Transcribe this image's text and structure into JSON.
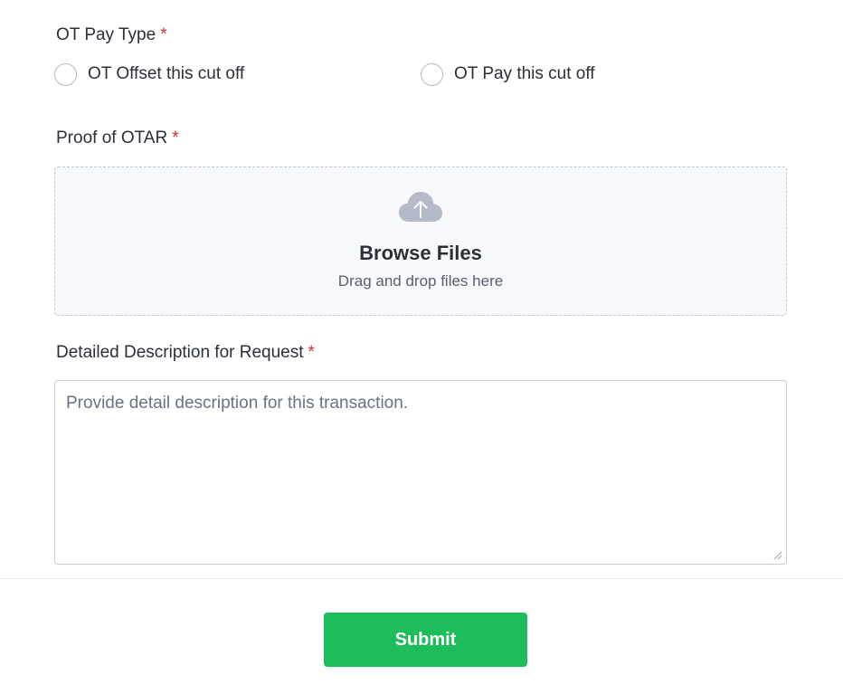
{
  "ot_pay_type": {
    "label": "OT Pay Type",
    "required_mark": "*",
    "options": [
      {
        "label": "OT Offset this cut off",
        "selected": false
      },
      {
        "label": "OT Pay this cut off",
        "selected": false
      }
    ]
  },
  "proof": {
    "label": "Proof of OTAR",
    "required_mark": "*",
    "dropzone": {
      "icon": "cloud-upload-icon",
      "title": "Browse Files",
      "subtitle": "Drag and drop files here"
    }
  },
  "description": {
    "label": "Detailed Description for Request",
    "required_mark": "*",
    "placeholder": "Provide detail description for this transaction.",
    "value": ""
  },
  "submit": {
    "label": "Submit"
  },
  "colors": {
    "accent": "#1dbd5b",
    "required": "#d92c2c",
    "text": "#2b2f38",
    "icon": "#b4bac8"
  }
}
